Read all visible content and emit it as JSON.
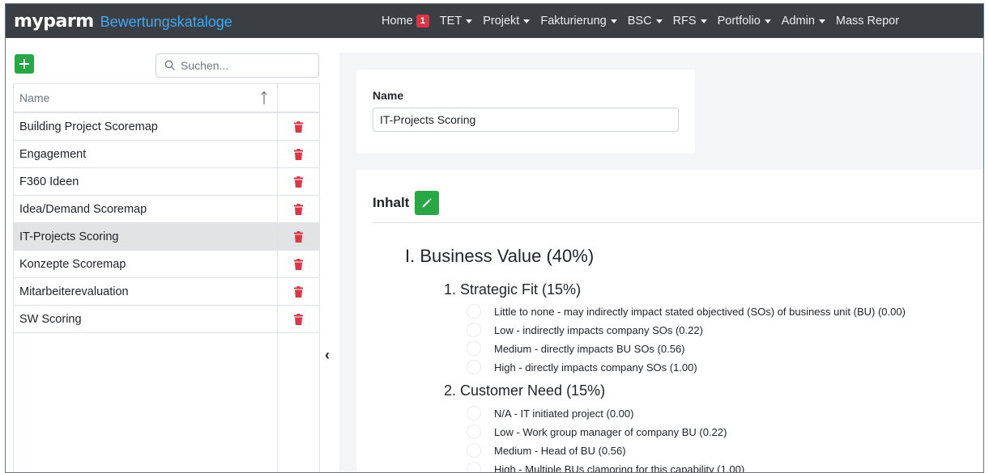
{
  "navbar": {
    "logo_text": "myparm",
    "brand_subtitle": "Bewertungskataloge",
    "items": [
      {
        "label": "Home",
        "badge": "1"
      },
      {
        "label": "TET",
        "dropdown": true
      },
      {
        "label": "Projekt",
        "dropdown": true
      },
      {
        "label": "Fakturierung",
        "dropdown": true
      },
      {
        "label": "BSC",
        "dropdown": true
      },
      {
        "label": "RFS",
        "dropdown": true
      },
      {
        "label": "Portfolio",
        "dropdown": true
      },
      {
        "label": "Admin",
        "dropdown": true
      },
      {
        "label": "Mass Repor"
      }
    ]
  },
  "sidebar": {
    "search_placeholder": "Suchen...",
    "column_header": "Name",
    "rows": [
      {
        "name": "Building Project Scoremap"
      },
      {
        "name": "Engagement"
      },
      {
        "name": "F360 Ideen"
      },
      {
        "name": "Idea/Demand Scoremap"
      },
      {
        "name": "IT-Projects Scoring",
        "selected": true
      },
      {
        "name": "Konzepte Scoremap"
      },
      {
        "name": "Mitarbeiterevaluation"
      },
      {
        "name": "SW Scoring"
      }
    ],
    "collapse_glyph": "‹"
  },
  "detail": {
    "name_label": "Name",
    "name_value": "IT-Projects Scoring",
    "content_title": "Inhalt",
    "section_title": "I. Business Value (40%)",
    "groups": [
      {
        "title": "1. Strategic Fit (15%)",
        "options": [
          "Little to none - may indirectly impact stated objectived (SOs) of business unit (BU) (0.00)",
          "Low - indirectly impacts company SOs (0.22)",
          "Medium - directly impacts BU SOs (0.56)",
          "High - directly impacts company SOs (1.00)"
        ]
      },
      {
        "title": "2. Customer Need (15%)",
        "options": [
          "N/A - IT initiated project (0.00)",
          "Low - Work group manager of company BU (0.22)",
          "Medium - Head of BU (0.56)",
          "High - Multiple BUs clamoring for this capability (1.00)"
        ]
      }
    ]
  },
  "colors": {
    "navbar_bg": "#3b3f44",
    "brand_blue": "#3fa9f5",
    "success_green": "#28a745",
    "danger_red": "#dc3545"
  }
}
